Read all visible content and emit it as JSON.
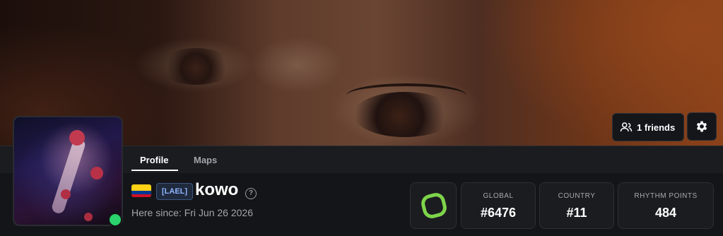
{
  "banner": {
    "description_icon": "profile-banner"
  },
  "friends": {
    "label": "1 friends",
    "icon": "friends-icon"
  },
  "settings": {
    "icon": "gear-icon"
  },
  "tabs": [
    {
      "label": "Profile",
      "active": true
    },
    {
      "label": "Maps",
      "active": false
    }
  ],
  "profile": {
    "flag": "colombia-flag-icon",
    "clan_tag": "[LAEL]",
    "username": "kowo",
    "since": "Here since: Fri Jun 26 2026",
    "online": true,
    "status_color": "#2ad36b"
  },
  "stats": {
    "icon": "rank-ring-icon",
    "global_label": "GLOBAL",
    "global_value": "#6476",
    "country_label": "COUNTRY",
    "country_value": "#11",
    "rp_label": "RHYTHM POINTS",
    "rp_value": "484"
  },
  "colors": {
    "accent_green": "#7ed44a",
    "clan_text": "#8fb5ff",
    "background": "#141518"
  }
}
